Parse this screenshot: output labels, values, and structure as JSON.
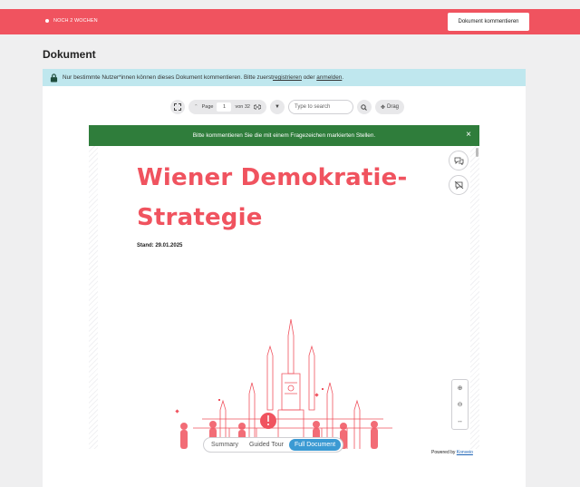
{
  "topbar": {
    "status_text": "NOCH 2 WOCHEN",
    "comment_button": "Dokument kommentieren",
    "accent_color": "#f0535f"
  },
  "page": {
    "title": "Dokument"
  },
  "notice": {
    "text_before": "Nur bestimmte Nutzer*innen können dieses Dokument kommentieren. Bitte zuerst ",
    "register_link": "registrieren",
    "middle": " oder ",
    "login_link": "anmelden",
    "end": ".",
    "icon": "lock-icon"
  },
  "toolbar": {
    "page_label": "Page",
    "page_value": "1",
    "page_total": "von 32",
    "search_placeholder": "Type to search",
    "drag_label": "Drag",
    "icons": [
      "fullscreen-icon",
      "chevron-up-icon",
      "link-icon",
      "chevron-down-icon",
      "search-icon",
      "move-icon"
    ]
  },
  "banner": {
    "text": "Bitte kommentieren Sie die mit einem Fragezeichen markierten Stellen.",
    "close": "×",
    "color": "#2f7d3b"
  },
  "document": {
    "title_line1": "Wiener Demokratie-",
    "title_line2": "Strategie",
    "stand": "Stand: 29.01.2025"
  },
  "side_buttons": [
    "comments-icon",
    "hide-comments-icon"
  ],
  "zoom": {
    "zoom_in": "⊕",
    "zoom_out": "⊖",
    "fit": "↔"
  },
  "view_modes": {
    "items": [
      "Summary",
      "Guided Tour",
      "Full Document"
    ],
    "active": "Full Document",
    "active_color": "#3b9ad3"
  },
  "footer": {
    "powered_prefix": "Powered by ",
    "powered_link": "Konveio"
  }
}
